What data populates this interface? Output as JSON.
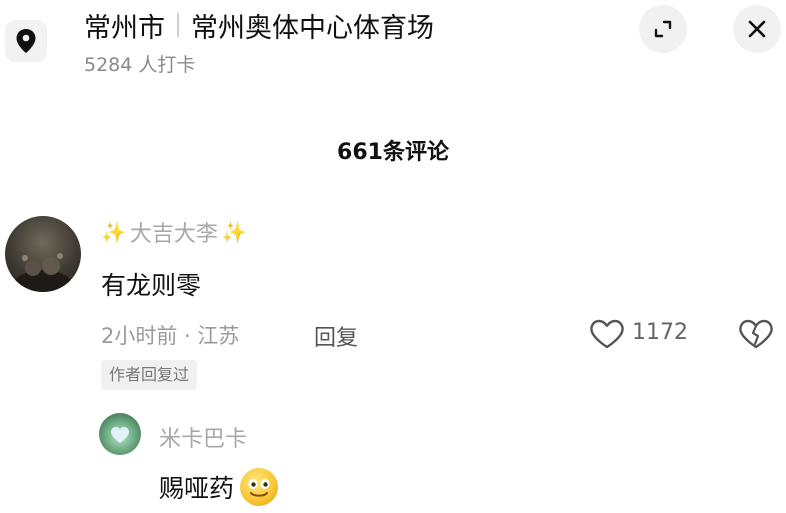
{
  "header": {
    "city": "常州市",
    "venue": "常州奥体中心体育场",
    "checkins": "5284 人打卡",
    "location_icon": "location-pin-icon",
    "expand_icon": "expand-icon",
    "close_icon": "close-icon"
  },
  "comments_count": "661条评论",
  "comment": {
    "username": "大吉大李",
    "username_decor": "✨",
    "text": "有龙则零",
    "time_location": "2小时前 · 江苏",
    "reply_label": "回复",
    "likes": "1172",
    "author_tag": "作者回复过"
  },
  "reply": {
    "username": "米卡巴卡",
    "text": "赐哑药",
    "emoji": "smiling-face-emoji"
  },
  "colors": {
    "accent_sparkle": "#f0c43c",
    "muted_text": "#9a9a9a",
    "button_bg": "#f1f1f1"
  }
}
